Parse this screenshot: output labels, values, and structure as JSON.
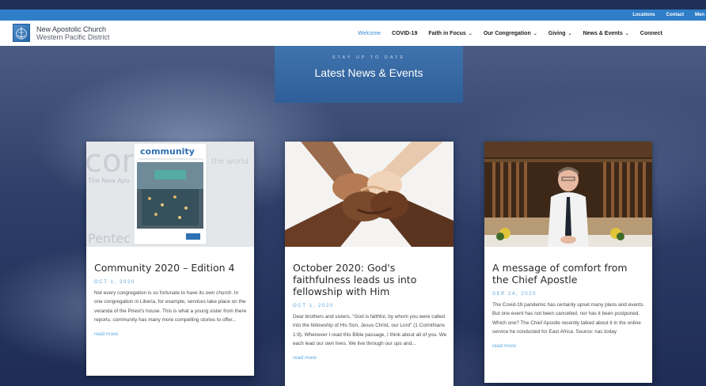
{
  "topbar": {
    "links": [
      "Locations",
      "Contact",
      "Men"
    ]
  },
  "brand": {
    "name": "New Apostolic Church",
    "district": "Western Pacific District",
    "logo_icon": "church-logo-icon"
  },
  "nav": {
    "items": [
      {
        "label": "Welcome",
        "active": true,
        "dropdown": false
      },
      {
        "label": "COVID-19",
        "active": false,
        "dropdown": false
      },
      {
        "label": "Faith in Focus",
        "active": false,
        "dropdown": true
      },
      {
        "label": "Our Congregation",
        "active": false,
        "dropdown": true
      },
      {
        "label": "Giving",
        "active": false,
        "dropdown": true
      },
      {
        "label": "News & Events",
        "active": false,
        "dropdown": true
      },
      {
        "label": "Connect",
        "active": false,
        "dropdown": false
      }
    ]
  },
  "news_header": {
    "kicker": "STAY UP TO DATE",
    "title": "Latest News & Events"
  },
  "cards": [
    {
      "title": "Community 2020 – Edition 4",
      "date": "OCT 1, 2020",
      "excerpt": "Not every congregation is so fortunate to have its own church. In one congregation in Liberia, for example, services take place on the veranda of the Priest's house. This is what a young sister from there reports. community has many more compelling stories to offer...",
      "more": "read more",
      "image_text": {
        "big_word": "com",
        "sub": "The New Apo",
        "magazine": "community",
        "right": "the world",
        "bottom": "Pentec"
      }
    },
    {
      "title": "October 2020: God's faithfulness leads us into fellowship with Him",
      "date": "OCT 1, 2020",
      "excerpt": "Dear brothers and sisters, \"God is faithful, by whom you were called into the fellowship of His Son, Jesus Christ, our Lord\" (1 Corinthians 1:9). Whenever I read this Bible passage, I think about all of you. We each lead our own lives. We live through our ups and...",
      "more": "read more"
    },
    {
      "title": "A message of comfort from the Chief Apostle",
      "date": "SEP 24, 2020",
      "excerpt": "The Covid-19 pandemic has certainly upset many plans and events. But one event has not been cancelled, nor has it been postponed. Which one? The Chief Apostle recently talked about it in the online service he conducted for East Africa. Source: nac.today",
      "more": "read more"
    }
  ],
  "colors": {
    "topbar": "#2f7fc8",
    "accent": "#3a8dd6",
    "news_box": "#3a6ba5",
    "date": "#58a6e0"
  }
}
